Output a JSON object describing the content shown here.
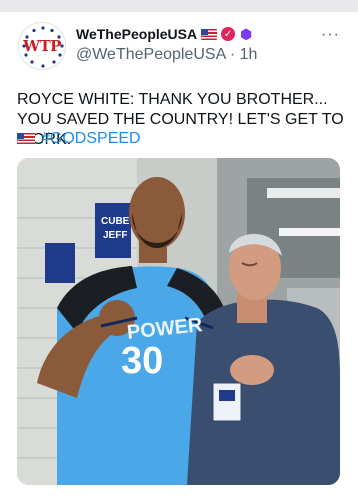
{
  "post": {
    "author": {
      "display_name": "WeThePeopleUSA",
      "handle": "@WeThePeopleUSA",
      "time": "1h",
      "avatar_text": "WTP",
      "avatar_top_text": "USA"
    },
    "text": "ROYCE WHITE: THANK YOU BROTHER... YOU SAVED THE COUNTRY!  LET'S GET TO WORK.",
    "hashtag": "#GODSPEED",
    "media": {
      "jersey_text": "POWER",
      "jersey_number": "30",
      "banner_text_1": "CUBE",
      "banner_text_2": "JEFF"
    }
  },
  "colors": {
    "verified_badge": "#e0245e",
    "purple_badge": "#7c3aed",
    "hashtag": "#1d8cf0",
    "jersey": "#4aa8e8"
  },
  "icons": [
    "verified-check-icon",
    "purple-hexagon-icon",
    "us-flag-icon",
    "more-options-icon"
  ]
}
